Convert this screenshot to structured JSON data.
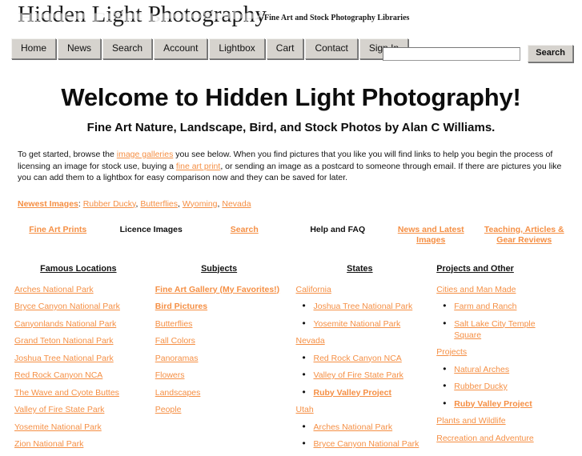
{
  "masthead": {
    "logo": "Hidden Light Photography",
    "tagline": "Fine Art and Stock Photography Libraries"
  },
  "nav": {
    "items": [
      {
        "label": "Home",
        "name": "home"
      },
      {
        "label": "News",
        "name": "news"
      },
      {
        "label": "Search",
        "name": "search"
      },
      {
        "label": "Account",
        "name": "account"
      },
      {
        "label": "Lightbox",
        "name": "lightbox"
      },
      {
        "label": "Cart",
        "name": "cart"
      },
      {
        "label": "Contact",
        "name": "contact"
      },
      {
        "label": "Sign In",
        "name": "sign-in"
      }
    ],
    "search": {
      "value": "",
      "placeholder": "",
      "button_label": "Search"
    }
  },
  "hero": {
    "title": "Welcome to Hidden Light Photography!",
    "subtitle": "Fine Art Nature, Landscape, Bird, and Stock Photos by Alan C Williams."
  },
  "intro": {
    "part1": "To get started, browse the ",
    "link1": "image galleries",
    "part2": " you see below. When you find pictures that you like you will find links to help you begin the process of licensing an image for stock use, buying a ",
    "link2": "fine art print",
    "part3": ", or sending an image as a postcard to someone through email. If there are pictures you like you can add them to a lightbox for easy comparison now and they can be saved for later."
  },
  "newest": {
    "label": "Newest Images",
    "separator": ": ",
    "items": [
      "Rubber Ducky",
      "Butterflies",
      "Wyoming",
      "Nevada"
    ]
  },
  "quicklinks": [
    {
      "label": "Fine Art Prints",
      "link": true
    },
    {
      "label": "Licence Images",
      "link": false
    },
    {
      "label": "Search",
      "link": true
    },
    {
      "label": "Help and FAQ",
      "link": false
    },
    {
      "label": "News and Latest Images",
      "link": true
    },
    {
      "label": "Teaching, Articles & Gear Reviews",
      "link": true
    }
  ],
  "columns": [
    {
      "heading": "Famous Locations",
      "items": [
        {
          "label": "Arches National Park",
          "sub": false,
          "bold": false
        },
        {
          "label": "Bryce Canyon National Park",
          "sub": false,
          "bold": false
        },
        {
          "label": "Canyonlands National Park",
          "sub": false,
          "bold": false
        },
        {
          "label": "Grand Teton National Park",
          "sub": false,
          "bold": false
        },
        {
          "label": "Joshua Tree National Park",
          "sub": false,
          "bold": false
        },
        {
          "label": "Red Rock Canyon NCA",
          "sub": false,
          "bold": false
        },
        {
          "label": "The Wave and Cyote Buttes",
          "sub": false,
          "bold": false
        },
        {
          "label": "Valley of Fire State Park",
          "sub": false,
          "bold": false
        },
        {
          "label": "Yosemite National Park",
          "sub": false,
          "bold": false
        },
        {
          "label": "Zion National Park",
          "sub": false,
          "bold": false
        }
      ]
    },
    {
      "heading": "Subjects",
      "items": [
        {
          "label": "Fine Art Gallery (My Favorites!)",
          "sub": false,
          "bold": true
        },
        {
          "label": "Bird Pictures",
          "sub": false,
          "bold": true
        },
        {
          "label": "Butterflies",
          "sub": false,
          "bold": false
        },
        {
          "label": "Fall Colors",
          "sub": false,
          "bold": false
        },
        {
          "label": "Panoramas",
          "sub": false,
          "bold": false
        },
        {
          "label": "Flowers",
          "sub": false,
          "bold": false
        },
        {
          "label": "Landscapes",
          "sub": false,
          "bold": false
        },
        {
          "label": "People",
          "sub": false,
          "bold": false
        }
      ]
    },
    {
      "heading": "States",
      "items": [
        {
          "label": "California",
          "sub": false,
          "bold": false
        },
        {
          "label": "Joshua Tree National Park",
          "sub": true,
          "bold": false
        },
        {
          "label": "Yosemite National Park",
          "sub": true,
          "bold": false
        },
        {
          "label": "Nevada",
          "sub": false,
          "bold": false
        },
        {
          "label": "Red Rock Canyon NCA",
          "sub": true,
          "bold": false
        },
        {
          "label": "Valley of Fire State Park",
          "sub": true,
          "bold": false
        },
        {
          "label": "Ruby Valley Project",
          "sub": true,
          "bold": true
        },
        {
          "label": "Utah",
          "sub": false,
          "bold": false
        },
        {
          "label": "Arches National Park",
          "sub": true,
          "bold": false
        },
        {
          "label": "Bryce Canyon National Park",
          "sub": true,
          "bold": false
        }
      ]
    },
    {
      "heading": "Projects and Other",
      "items": [
        {
          "label": "Cities and Man Made",
          "sub": false,
          "bold": false
        },
        {
          "label": "Farm and Ranch",
          "sub": true,
          "bold": false
        },
        {
          "label": "Salt Lake City Temple Square",
          "sub": true,
          "bold": false
        },
        {
          "label": "Projects",
          "sub": false,
          "bold": false
        },
        {
          "label": "Natural Arches",
          "sub": true,
          "bold": false
        },
        {
          "label": "Rubber Ducky",
          "sub": true,
          "bold": false
        },
        {
          "label": "Ruby Valley Project",
          "sub": true,
          "bold": true
        },
        {
          "label": "Plants and Wildlife",
          "sub": false,
          "bold": false
        },
        {
          "label": "Recreation and Adventure",
          "sub": false,
          "bold": false
        }
      ]
    }
  ],
  "colors": {
    "link": "#f58f44",
    "text": "#111111",
    "button_face": "#d6d3ce"
  }
}
